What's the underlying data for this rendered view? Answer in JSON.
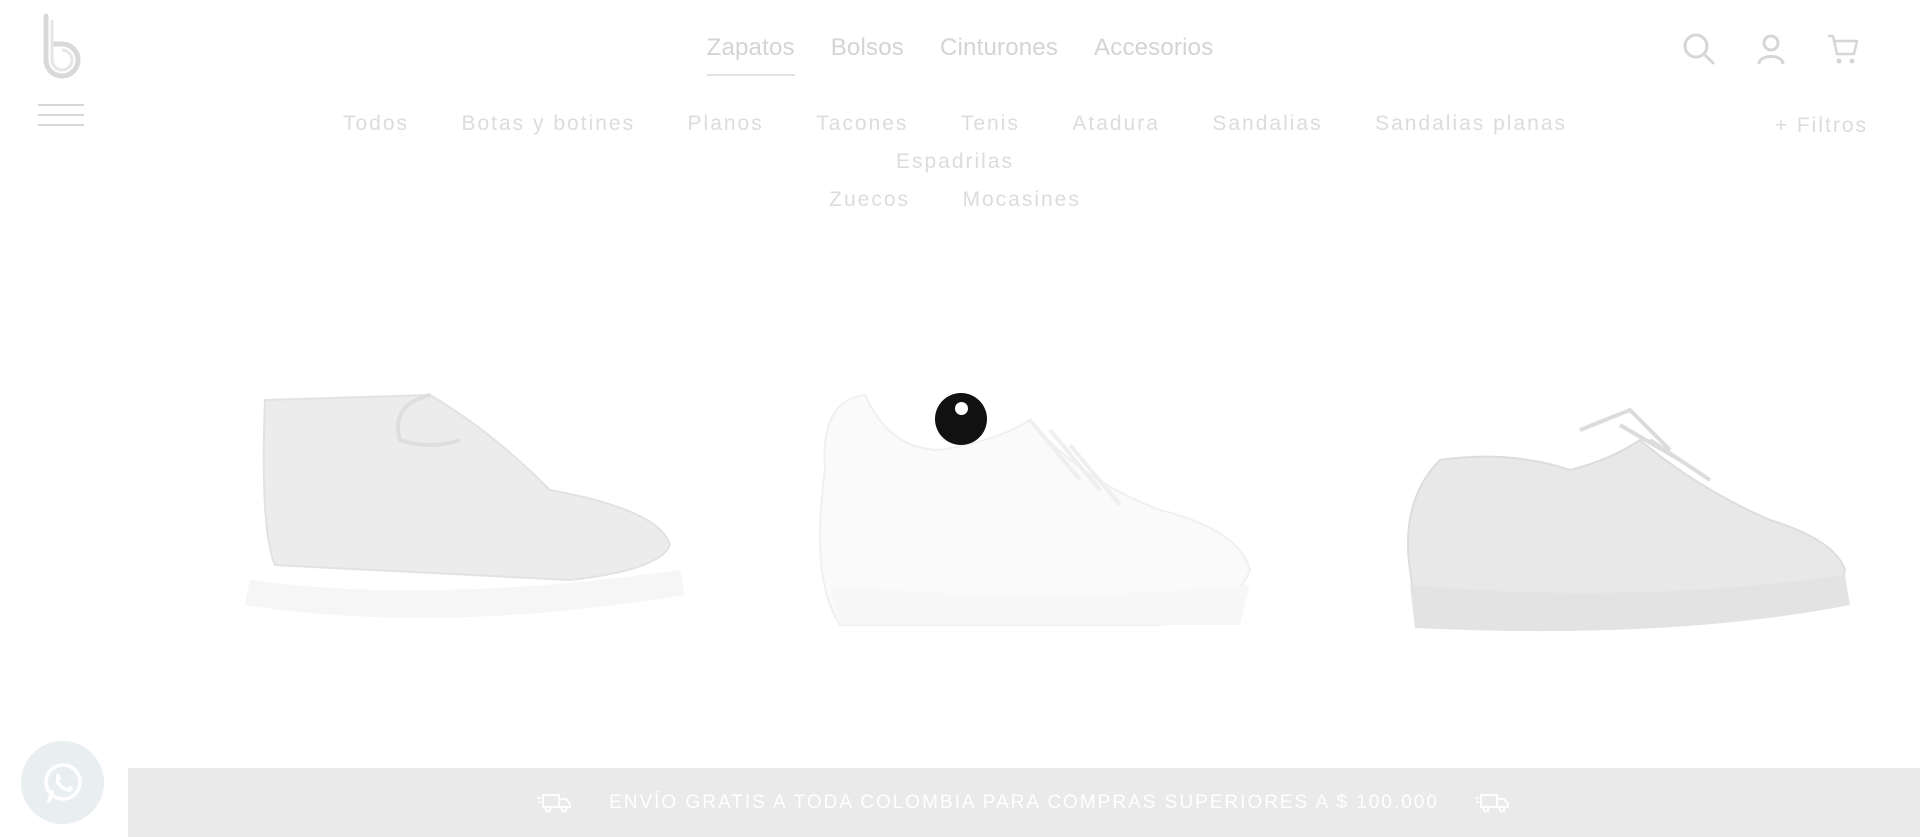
{
  "header": {
    "logo_text": "b",
    "nav": [
      {
        "label": "Zapatos",
        "active": true
      },
      {
        "label": "Bolsos",
        "active": false
      },
      {
        "label": "Cinturones",
        "active": false
      },
      {
        "label": "Accesorios",
        "active": false
      }
    ],
    "icons": [
      "search-icon",
      "user-icon",
      "cart-icon",
      "menu-icon"
    ]
  },
  "subnav": {
    "items": [
      "Todos",
      "Botas y botines",
      "Planos",
      "Tacones",
      "Tenis",
      "Atadura",
      "Sandalias",
      "Sandalias planas",
      "Espadrilas",
      "Zuecos",
      "Mocasines"
    ],
    "filters_label": "+ Filtros"
  },
  "products": [
    {
      "name": "slip-on-sneaker",
      "color": "#dcdcdc"
    },
    {
      "name": "white-lace-sneaker",
      "color": "#fafafa"
    },
    {
      "name": "patent-lace-sneaker",
      "color": "#e4e4e4"
    }
  ],
  "loader": {
    "visible": true
  },
  "banner": {
    "text": "ENVÍO GRATIS A TODA COLOMBIA PARA COMPRAS SUPERIORES A $ 100.000"
  },
  "colors": {
    "nav_text": "#d4d4d4",
    "banner_bg": "#eaeaea",
    "loader": "#111111"
  }
}
